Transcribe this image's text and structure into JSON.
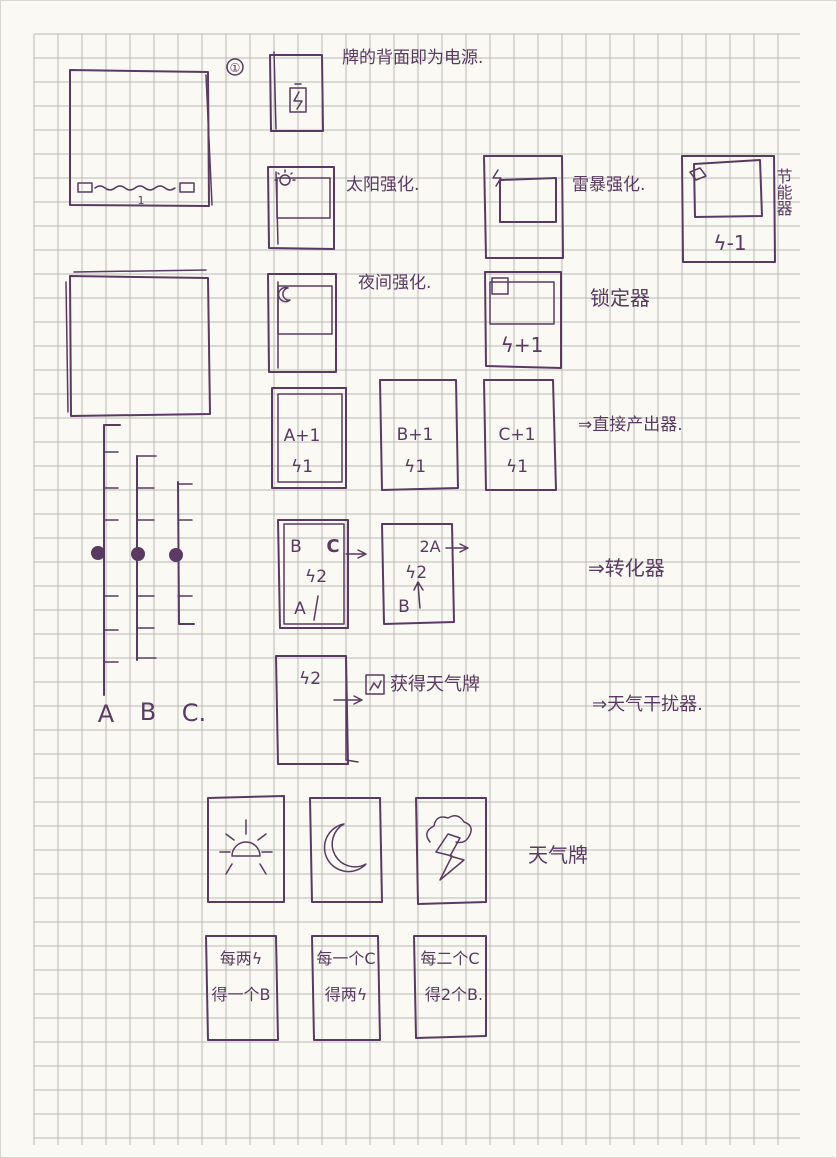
{
  "page_number": "①",
  "notes": {
    "card_back_power": "牌的背面即为电源.",
    "solar_boost": "太阳强化.",
    "thunder_boost": "雷暴强化.",
    "regulator": "节能器",
    "night_boost": "夜间强化.",
    "locker": "锁定器",
    "direct_producer": "⇒直接产出器.",
    "converter": "⇒转化器",
    "get_weather_card": "获得天气牌",
    "weather_disruptor": "⇒天气干扰器.",
    "weather_cards": "天气牌"
  },
  "battery_track": {
    "mark": "1"
  },
  "gauge": {
    "labels": [
      "A",
      "B",
      "C."
    ]
  },
  "cards": {
    "regulator_card": "ϟ-1",
    "locker_card": "ϟ+1",
    "producer_a": [
      "A+1",
      "ϟ1"
    ],
    "producer_b": [
      "B+1",
      "ϟ1"
    ],
    "producer_c": [
      "C+1",
      "ϟ1"
    ],
    "converter_1": [
      "B",
      "C",
      "ϟ2",
      "A"
    ],
    "converter_2": [
      "2A",
      "ϟ2",
      "B"
    ],
    "disruptor": "ϟ2"
  },
  "weather_rules": [
    [
      "每两ϟ",
      "得一个B"
    ],
    [
      "每一个C",
      "得两ϟ"
    ],
    [
      "每二个C",
      "得2个B."
    ]
  ]
}
